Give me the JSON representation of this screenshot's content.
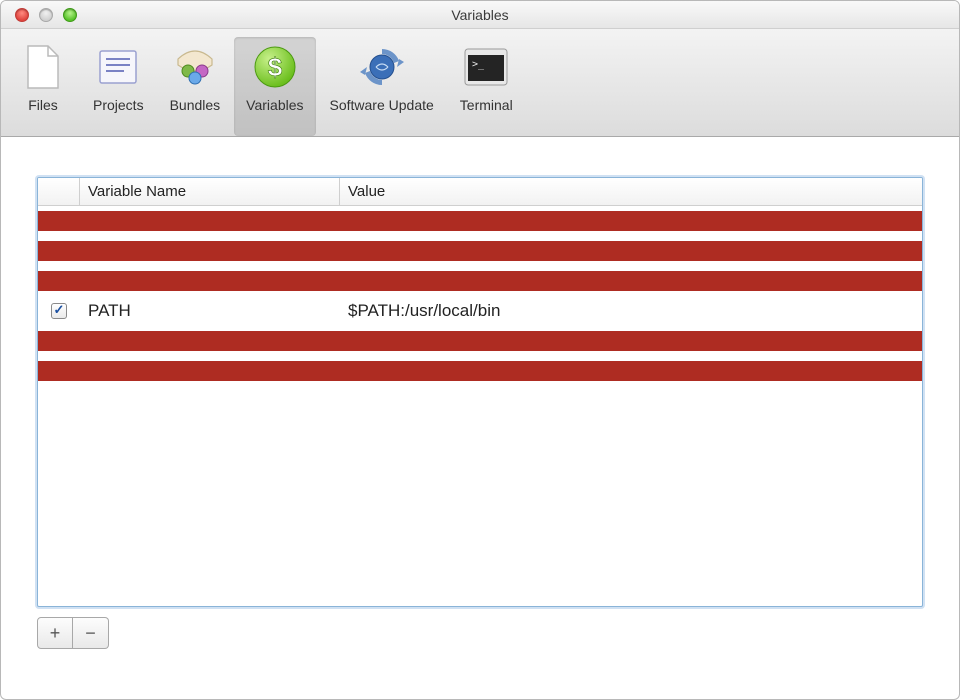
{
  "window": {
    "title": "Variables"
  },
  "toolbar": {
    "selected_index": 3,
    "items": [
      {
        "id": "files-tab",
        "label": "Files"
      },
      {
        "id": "projects-tab",
        "label": "Projects"
      },
      {
        "id": "bundles-tab",
        "label": "Bundles"
      },
      {
        "id": "variables-tab",
        "label": "Variables"
      },
      {
        "id": "software-update-tab",
        "label": "Software Update"
      },
      {
        "id": "terminal-tab",
        "label": "Terminal"
      }
    ]
  },
  "table": {
    "columns": {
      "name": "Variable Name",
      "value": "Value"
    },
    "rows": [
      {
        "checked": true,
        "name": "",
        "value": "",
        "redacted": true
      },
      {
        "checked": true,
        "name": "",
        "value": "",
        "redacted": true
      },
      {
        "checked": true,
        "name": "",
        "value": "",
        "redacted": true
      },
      {
        "checked": true,
        "name": "PATH",
        "value": "$PATH:/usr/local/bin",
        "redacted": false
      },
      {
        "checked": true,
        "name": "",
        "value": "",
        "redacted": true
      },
      {
        "checked": true,
        "name": "",
        "value": "",
        "redacted": true
      }
    ]
  },
  "buttons": {
    "add": "+",
    "remove": "−"
  }
}
